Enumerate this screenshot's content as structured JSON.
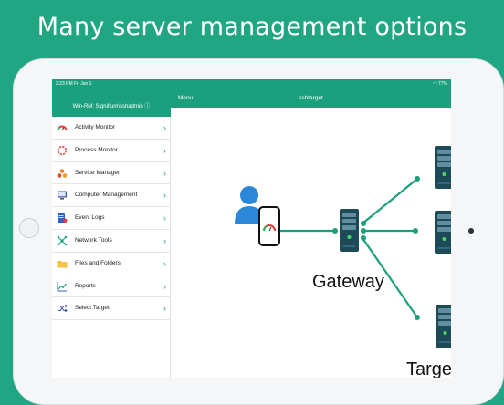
{
  "headline": "Many server management options",
  "status_bar": {
    "time": "2:23 PM",
    "date": "Fri Jan 1",
    "battery": "77%"
  },
  "sidebar": {
    "header": "Win-RM: Signifium\\sshadmin",
    "items": [
      {
        "label": "Activity Monitor",
        "icon": "activity-gauge-icon"
      },
      {
        "label": "Process Monitor",
        "icon": "process-ring-icon"
      },
      {
        "label": "Service Manager",
        "icon": "service-dots-icon"
      },
      {
        "label": "Computer Management",
        "icon": "computer-icon"
      },
      {
        "label": "Event Logs",
        "icon": "event-logs-icon"
      },
      {
        "label": "Network Tools",
        "icon": "network-icon"
      },
      {
        "label": "Files and Folders",
        "icon": "folder-icon"
      },
      {
        "label": "Reports",
        "icon": "reports-chart-icon"
      },
      {
        "label": "Select Target",
        "icon": "shuffle-icon"
      }
    ]
  },
  "nav": {
    "menu_label": "Menu",
    "title": "sshtarget"
  },
  "diagram": {
    "gateway_label": "Gateway",
    "targets_label": "Targets"
  },
  "colors": {
    "brand": "#1aa07d",
    "server": "#1e4a57"
  }
}
